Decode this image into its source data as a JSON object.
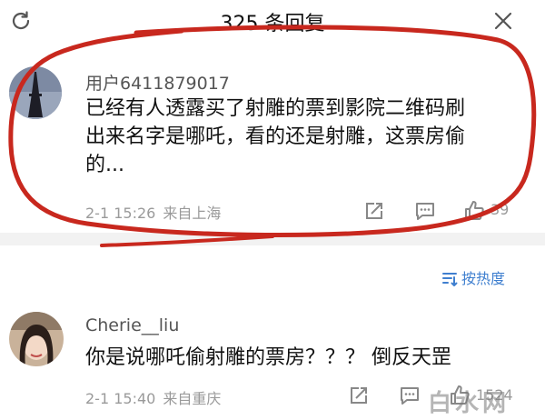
{
  "header": {
    "title": "325 条回复"
  },
  "comment1": {
    "username": "用户6411879017",
    "text_lines": [
      "已经有人透露买了射雕的票到影院二维码刷",
      "出来名字是哪吒，看的还是射雕，这票房偷",
      "的..."
    ],
    "time": "2-1 15:26",
    "location": "来自上海",
    "likes": "39"
  },
  "sort": {
    "label": "按热度"
  },
  "comment2": {
    "username": "Cherie__liu",
    "text": "你是说哪吒偷射雕的票房？？？ 倒反天罡",
    "time": "2-1 15:40",
    "location": "来自重庆",
    "likes": "1524"
  },
  "watermark": {
    "text": "白水网"
  },
  "colors": {
    "annotation_red": "#c8281e",
    "link_blue": "#3f7fcf",
    "meta_gray": "#9a9a9a"
  },
  "icons": [
    "refresh-icon",
    "close-icon",
    "share-icon",
    "reply-icon",
    "like-icon",
    "sort-icon"
  ]
}
